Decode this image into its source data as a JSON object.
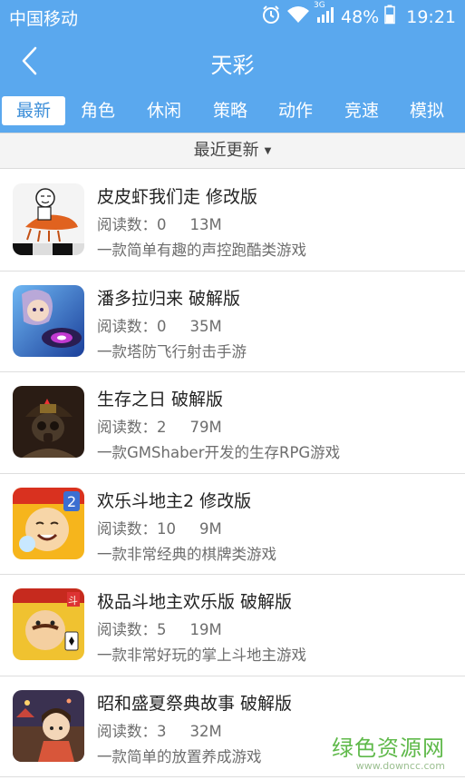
{
  "status_bar": {
    "carrier": "中国移动",
    "network": "3G",
    "battery": "48%",
    "time": "19:21",
    "icons": [
      "alarm-icon",
      "wifi-icon",
      "signal-icon",
      "battery-icon"
    ]
  },
  "header": {
    "title": "天彩",
    "back_icon": "chevron-left-icon"
  },
  "tabs": [
    {
      "label": "最新",
      "active": true
    },
    {
      "label": "角色",
      "active": false
    },
    {
      "label": "休闲",
      "active": false
    },
    {
      "label": "策略",
      "active": false
    },
    {
      "label": "动作",
      "active": false
    },
    {
      "label": "竞速",
      "active": false
    },
    {
      "label": "模拟",
      "active": false
    }
  ],
  "sort": {
    "label": "最近更新",
    "caret": "▼"
  },
  "games": [
    {
      "title": "皮皮虾我们走  修改版",
      "reads_label": "阅读数：0",
      "size": "13M",
      "desc": "一款简单有趣的声控跑酷类游戏"
    },
    {
      "title": "潘多拉归来  破解版",
      "reads_label": "阅读数：0",
      "size": "35M",
      "desc": "一款塔防飞行射击手游"
    },
    {
      "title": "生存之日  破解版",
      "reads_label": "阅读数：2",
      "size": "79M",
      "desc": "一款GMShaber开发的生存RPG游戏"
    },
    {
      "title": "欢乐斗地主2  修改版",
      "reads_label": "阅读数：10",
      "size": "9M",
      "desc": "一款非常经典的棋牌类游戏"
    },
    {
      "title": "极品斗地主欢乐版  破解版",
      "reads_label": "阅读数：5",
      "size": "19M",
      "desc": "一款非常好玩的掌上斗地主游戏"
    },
    {
      "title": "昭和盛夏祭典故事  破解版",
      "reads_label": "阅读数：3",
      "size": "32M",
      "desc": "一款简单的放置养成游戏"
    }
  ],
  "watermark": {
    "main": "绿色资源网",
    "sub": "www.downcc.com"
  },
  "colors": {
    "primary": "#5aa8ee",
    "active_tab_text": "#3e8fd9",
    "watermark": "#5fb94a"
  }
}
